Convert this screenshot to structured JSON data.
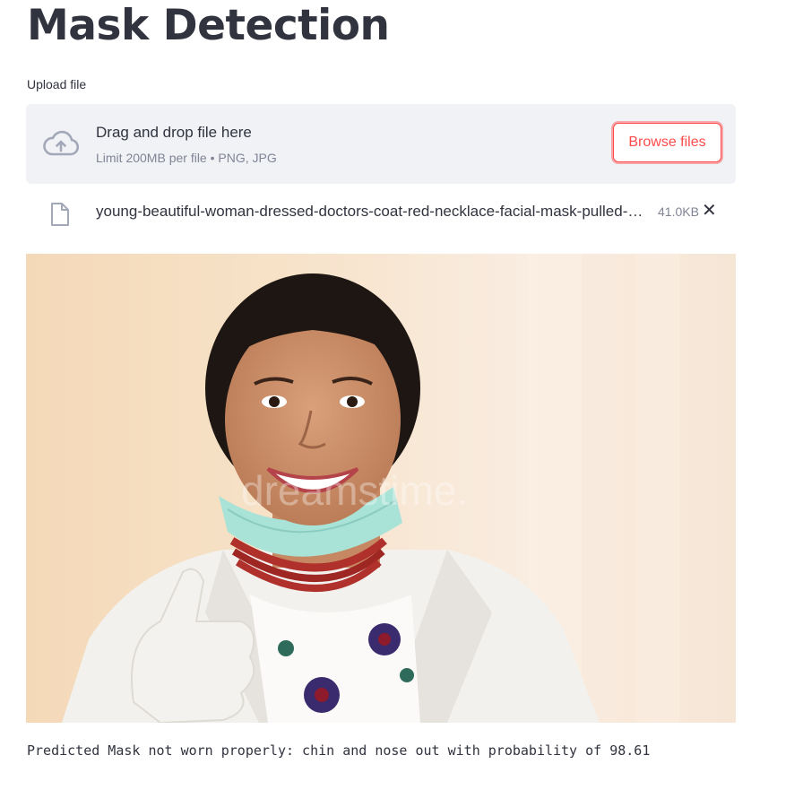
{
  "page": {
    "title": "Mask Detection"
  },
  "uploader": {
    "label": "Upload file",
    "drag_text": "Drag and drop file here",
    "limit_text": "Limit 200MB per file • PNG, JPG",
    "browse_label": "Browse files",
    "icon": "cloud-upload-icon"
  },
  "uploaded_file": {
    "name": "young-beautiful-woman-dressed-doctors-coat-red-necklace-facial-mask-pulled-…",
    "size": "41.0KB",
    "remove_glyph": "✕",
    "icon": "file-icon"
  },
  "image": {
    "watermark": "dreamstime."
  },
  "result": {
    "text": "Predicted Mask not worn properly: chin and nose out with probability of 98.61"
  },
  "colors": {
    "accent": "#ff4b4b",
    "text": "#31333f",
    "muted": "#808495",
    "dropzone_bg": "#f0f2f6"
  }
}
